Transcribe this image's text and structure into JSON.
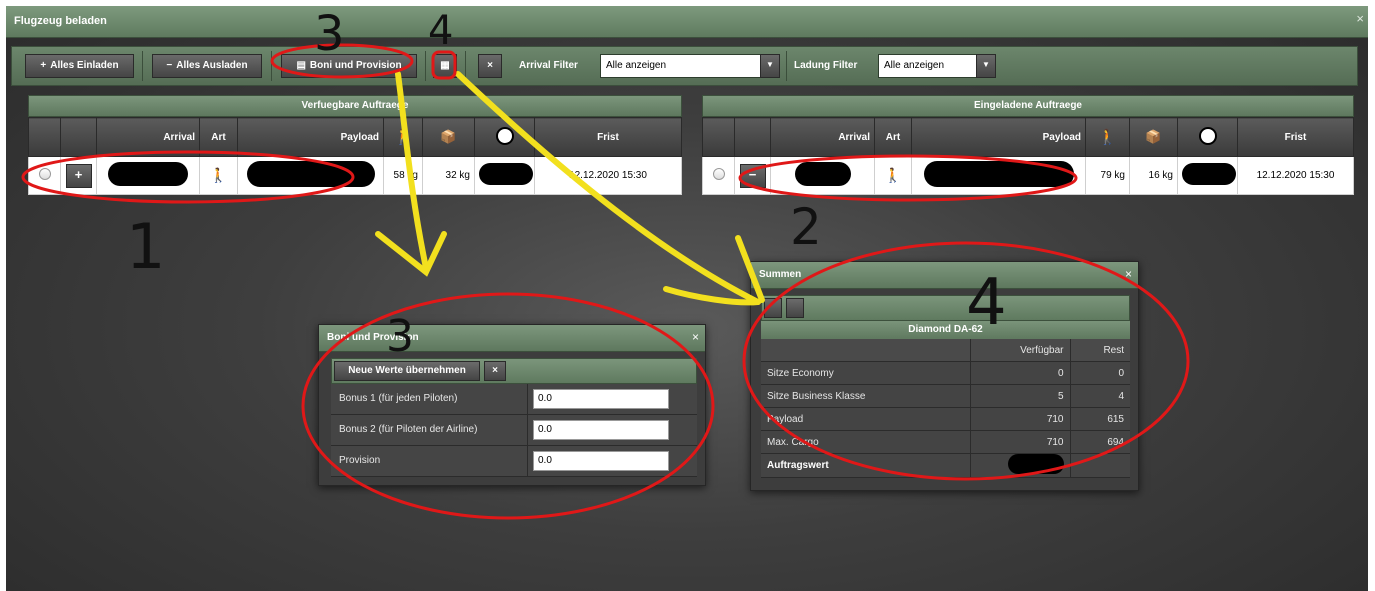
{
  "window": {
    "title": "Flugzeug beladen",
    "close": "×"
  },
  "toolbar": {
    "load_all": "Alles Einladen",
    "unload_all": "Alles Ausladen",
    "boni": "Boni und Provision",
    "calc_icon": "calculator-icon",
    "clear": "×",
    "arrival_filter_label": "Arrival Filter",
    "arrival_filter_value": "Alle anzeigen",
    "ladung_filter_label": "Ladung Filter",
    "ladung_filter_value": "Alle anzeigen"
  },
  "left_panel": {
    "title": "Verfuegbare Auftraege",
    "columns": [
      "",
      "",
      "Arrival",
      "Art",
      "Payload",
      "passenger-icon",
      "cargo-icon",
      "fuel-icon",
      "Frist"
    ],
    "row": {
      "button": "+",
      "weight1": "58 kg",
      "weight2": "32 kg",
      "frist": "12.12.2020 15:30"
    }
  },
  "right_panel": {
    "title": "Eingeladene Auftraege",
    "columns": [
      "",
      "",
      "Arrival",
      "Art",
      "Payload",
      "passenger-icon",
      "cargo-icon",
      "fuel-icon",
      "Frist"
    ],
    "row": {
      "button": "−",
      "weight1": "79 kg",
      "weight2": "16 kg",
      "frist": "12.12.2020 15:30"
    }
  },
  "boni_dialog": {
    "title": "Boni und Provision",
    "apply": "Neue Werte übernehmen",
    "clear": "×",
    "fields": [
      {
        "label": "Bonus 1 (für jeden Piloten)",
        "value": "0.0"
      },
      {
        "label": "Bonus 2 (für Piloten der Airline)",
        "value": "0.0"
      },
      {
        "label": "Provision",
        "value": "0.0"
      }
    ]
  },
  "summen_dialog": {
    "title": "Summen",
    "aircraft": "Diamond DA-62",
    "col_available": "Verfügbar",
    "col_rest": "Rest",
    "rows": [
      {
        "label": "Sitze Economy",
        "available": "0",
        "rest": "0"
      },
      {
        "label": "Sitze Business Klasse",
        "available": "5",
        "rest": "4"
      },
      {
        "label": "Payload",
        "available": "710",
        "rest": "615"
      },
      {
        "label": "Max. Cargo",
        "available": "710",
        "rest": "694"
      }
    ],
    "footer_label": "Auftragswert"
  },
  "annotations": {
    "n1": "1",
    "n2": "2",
    "n3": "3",
    "n3b": "3",
    "n4": "4",
    "n4b": "4"
  },
  "colors": {
    "accent": "#6b876b",
    "annotation_red": "#e01818",
    "annotation_yellow": "#f2e01e"
  }
}
